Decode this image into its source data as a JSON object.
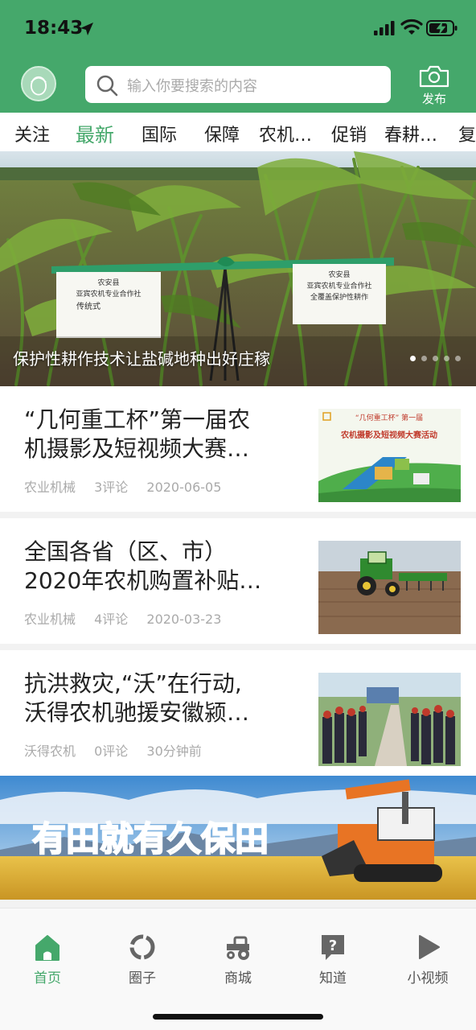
{
  "status_bar": {
    "time": "18:43"
  },
  "header": {
    "search_placeholder": "输入你要搜索的内容",
    "publish_label": "发布",
    "accent_color": "#45a86b"
  },
  "tabs": [
    {
      "label": "关注",
      "active": false
    },
    {
      "label": "最新",
      "active": true
    },
    {
      "label": "国际",
      "active": false
    },
    {
      "label": "保障",
      "active": false
    },
    {
      "label": "农机…",
      "active": false
    },
    {
      "label": "促销",
      "active": false
    },
    {
      "label": "春耕…",
      "active": false
    },
    {
      "label": "复",
      "active": false
    }
  ],
  "banner": {
    "caption": "保护性耕作技术让盐碱地种出好庄稼",
    "sign_left": [
      "农安县",
      "亚宾农机专业合作社",
      "传统式"
    ],
    "sign_right": [
      "农安县",
      "亚宾农机专业合作社",
      "全覆盖保护性耕作"
    ],
    "slide_count": 5,
    "active_slide": 1
  },
  "news": [
    {
      "title_line1": "“几何重工杯”第一届农",
      "title_line2": "机摄影及短视频大赛…",
      "source": "农业机械",
      "comments": "3评论",
      "date": "2020-06-05",
      "thumb_text1": "“几何重工杯” 第一届",
      "thumb_text2": "农机摄影及短视频大赛活动"
    },
    {
      "title_line1": "全国各省（区、市）",
      "title_line2": "2020年农机购置补贴…",
      "source": "农业机械",
      "comments": "4评论",
      "date": "2020-03-23"
    },
    {
      "title_line1": "抗洪救灾,“沃”在行动,",
      "title_line2": "沃得农机驰援安徽颍…",
      "source": "沃得农机",
      "comments": "0评论",
      "date": "30分钟前"
    }
  ],
  "ad_banner": {
    "text": "有田就有久保田"
  },
  "bottom_nav": [
    {
      "label": "首页",
      "icon": "home-icon",
      "active": true
    },
    {
      "label": "圈子",
      "icon": "circle-icon",
      "active": false
    },
    {
      "label": "商城",
      "icon": "tractor-icon",
      "active": false
    },
    {
      "label": "知道",
      "icon": "question-icon",
      "active": false
    },
    {
      "label": "小视频",
      "icon": "play-icon",
      "active": false
    }
  ]
}
